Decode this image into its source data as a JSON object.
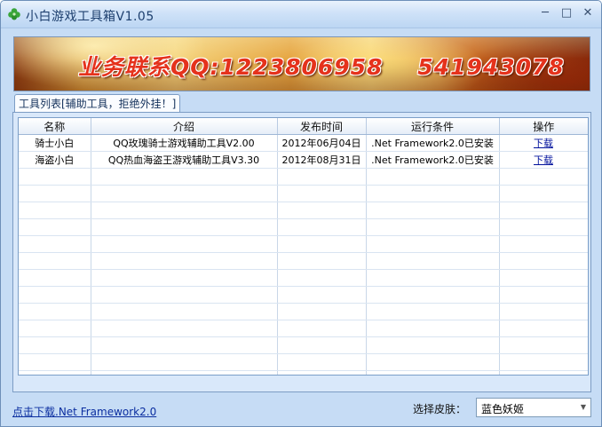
{
  "window": {
    "title": "小白游戏工具箱V1.05",
    "controls": {
      "minimize": "─",
      "maximize": "□",
      "close": "✕"
    }
  },
  "banner": {
    "text": "业务联系QQ:1223806958    541943078"
  },
  "tabs": [
    {
      "label": "工具列表[辅助工具，拒绝外挂！]"
    }
  ],
  "table": {
    "columns": [
      "名称",
      "介绍",
      "发布时间",
      "运行条件",
      "操作"
    ],
    "rows": [
      {
        "name": "骑士小白",
        "desc": "QQ玫瑰骑士游戏辅助工具V2.00",
        "date": "2012年06月04日",
        "req": ".Net Framework2.0已安装",
        "action": "下载"
      },
      {
        "name": "海盗小白",
        "desc": "QQ热血海盗王游戏辅助工具V3.30",
        "date": "2012年08月31日",
        "req": ".Net Framework2.0已安装",
        "action": "下载"
      }
    ]
  },
  "footer": {
    "download_link": "点击下载.Net Framework2.0",
    "skin_label": "选择皮肤：",
    "skin_selected": "蓝色妖姬"
  },
  "colors": {
    "banner_text": "#e5321c",
    "window_bg": "#c6dcf5",
    "link": "#00109c"
  },
  "icons": {
    "app": "clover-icon",
    "dropdown": "triangle-down-icon"
  }
}
